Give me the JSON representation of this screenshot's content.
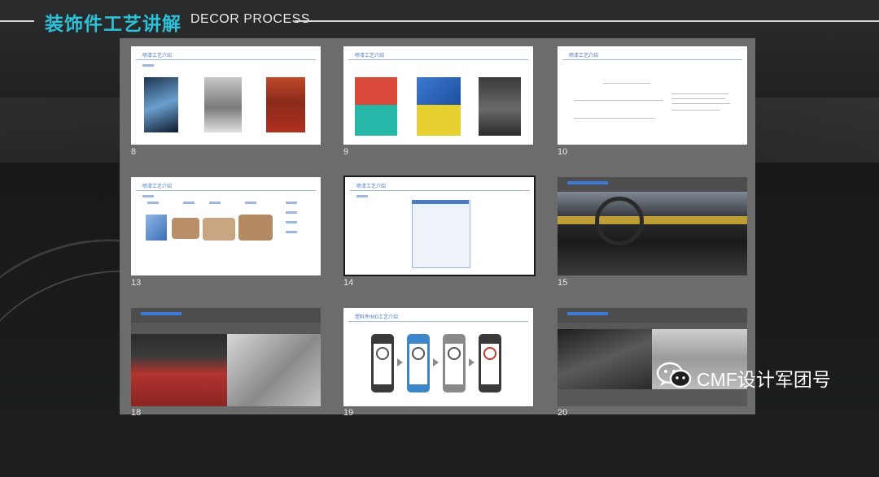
{
  "header": {
    "title": "装饰件工艺讲解",
    "subtitle": "DECOR PROCESS"
  },
  "colors": {
    "accent": "#2cc1d8",
    "slide_title": "#4a7dbf",
    "panel": "#6c6c6c"
  },
  "slides": [
    {
      "number": "8",
      "title": "喷漆工艺介绍"
    },
    {
      "number": "9",
      "title": "喷漆工艺介绍"
    },
    {
      "number": "10",
      "title": "喷漆工艺介绍"
    },
    {
      "number": "13",
      "title": "喷漆工艺介绍"
    },
    {
      "number": "14",
      "title": "喷漆工艺介绍",
      "selected": true
    },
    {
      "number": "15",
      "title": ""
    },
    {
      "number": "18",
      "title": ""
    },
    {
      "number": "19",
      "title": "塑料件IMD工艺介绍"
    },
    {
      "number": "20",
      "title": ""
    }
  ],
  "watermark": {
    "icon": "wechat-icon",
    "text": "CMF设计军团号"
  }
}
